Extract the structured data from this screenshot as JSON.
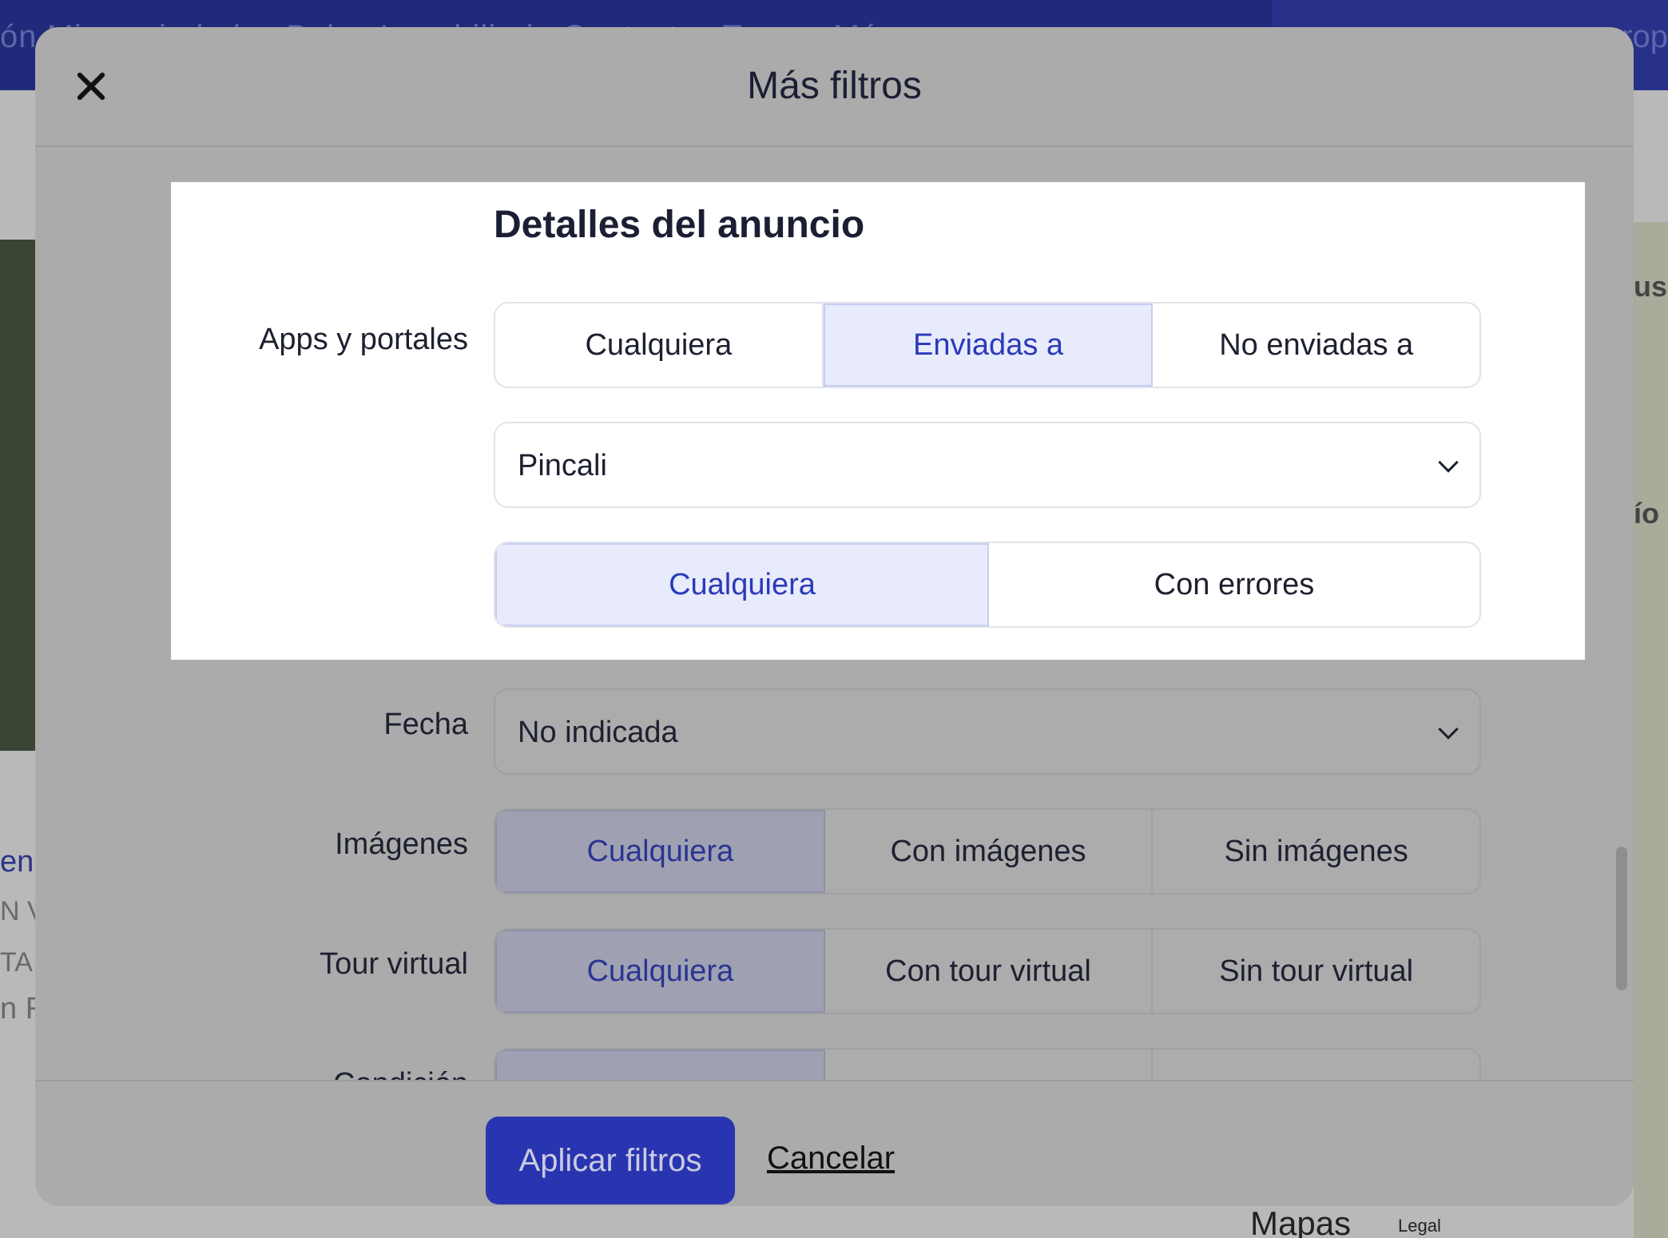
{
  "background": {
    "nav_left_text": "ón   Mi propiedades   Bolsa Inmobiliaria   Contactos   Tareas   Más",
    "nav_right_text": "rop",
    "left_link": "en",
    "left_text_1": "N VE",
    "left_text_2": "TA",
    "left_text_3": "n R",
    "map_label_1": "usa",
    "map_label_2": "ío",
    "maps_logo": "Mapas",
    "maps_legal": "Legal"
  },
  "modal": {
    "title": "Más filtros",
    "section_title": "Detalles del anuncio",
    "apps": {
      "label": "Apps y portales",
      "options": [
        "Cualquiera",
        "Enviadas a",
        "No enviadas a"
      ],
      "selected": "Enviadas a",
      "portal_value": "Pincali",
      "status_options": [
        "Cualquiera",
        "Con errores"
      ],
      "status_selected": "Cualquiera"
    },
    "fecha": {
      "label": "Fecha",
      "value": "No indicada"
    },
    "imagenes": {
      "label": "Imágenes",
      "options": [
        "Cualquiera",
        "Con imágenes",
        "Sin imágenes"
      ]
    },
    "tour": {
      "label": "Tour virtual",
      "options": [
        "Cualquiera",
        "Con tour virtual",
        "Sin tour virtual"
      ]
    },
    "condicion": {
      "label": "Condición"
    },
    "apply_label": "Aplicar filtros",
    "cancel_label": "Cancelar"
  }
}
